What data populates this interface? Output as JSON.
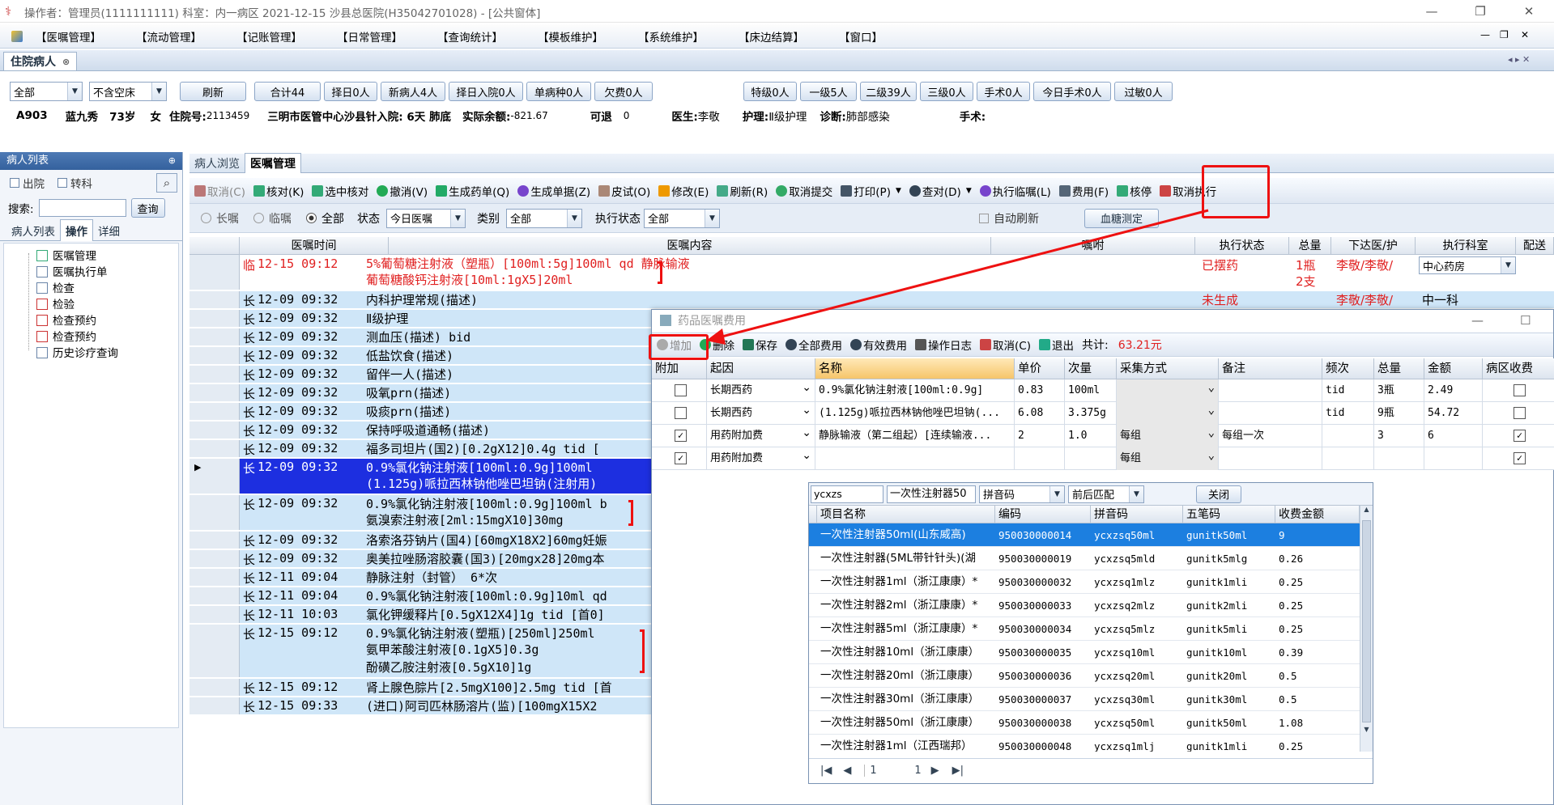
{
  "window": {
    "title": "操作者：管理员(1111111111) 科室：内一病区 2021-12-15 沙县总医院(H35042701028) - [公共窗体]",
    "min": "—",
    "restore": "❐",
    "close": "✕"
  },
  "menu": [
    "【医嘱管理】",
    "【流动管理】",
    "【记账管理】",
    "【日常管理】",
    "【查询统计】",
    "【模板维护】",
    "【系统维护】",
    "【床边结算】",
    "【窗口】"
  ],
  "doc_tab": "住院病人",
  "filters": {
    "scope": "全部",
    "bed": "不含空床",
    "refresh": "刷新",
    "buttons": [
      "合计44",
      "择日0人",
      "新病人4人",
      "择日入院0人",
      "单病种0人",
      "欠费0人"
    ],
    "buttons2": [
      "特级0人",
      "一级5人",
      "二级39人",
      "三级0人",
      "手术0人",
      "今日手术0人",
      "过敏0人"
    ]
  },
  "patient": {
    "bed": "A903",
    "name": "蓝九秀",
    "age": "73岁",
    "sex": "女",
    "inpatient_label": "住院号:",
    "inpatient_no": "2113459",
    "address": "三明市医管中心沙县针入院: 6天 肺底",
    "balance_label": "实际余额:",
    "balance": "-821.67",
    "retreat_label": "可退",
    "retreat": "0",
    "doctor_label": "医生:",
    "doctor": "李敬",
    "nursing_label": "护理:",
    "nursing": "Ⅱ级护理",
    "diag_label": "诊断:",
    "diag": "肺部感染",
    "op_label": "手术:"
  },
  "left": {
    "header": "病人列表",
    "pin": "⊕",
    "chk1": "出院",
    "chk2": "转科",
    "search_label": "搜索:",
    "query_btn": "查询",
    "tabs": [
      "病人列表",
      "操作",
      "详细"
    ],
    "tree": [
      "医嘱管理",
      "医嘱执行单",
      "检查",
      "检验",
      "检查预约",
      "检查预约",
      "历史诊疗查询"
    ]
  },
  "main": {
    "tabs": [
      "病人浏览",
      "医嘱管理"
    ],
    "toolbar": [
      "取消(C)",
      "核对(K)",
      "选中核对",
      "撤消(V)",
      "生成药单(Q)",
      "生成单据(Z)",
      "皮试(O)",
      "修改(E)",
      "刷新(R)",
      "取消提交",
      "打印(P)",
      "查对(D)",
      "执行临嘱(L)",
      "费用(F)",
      "核停",
      "取消执行"
    ],
    "filter": {
      "long": "长嘱",
      "temp": "临嘱",
      "all": "全部",
      "state_label": "状态",
      "state": "今日医嘱",
      "type_label": "类别",
      "type": "全部",
      "exec_label": "执行状态",
      "exec": "全部",
      "auto": "自动刷新",
      "blood_btn": "血糖测定"
    },
    "columns": [
      "医嘱时间",
      "医嘱内容",
      "嘱咐",
      "执行状态",
      "总量",
      "下达医/护",
      "执行科室",
      "配送"
    ],
    "rows": [
      {
        "type": "临",
        "time": "12-15 09:12",
        "content": "5%葡萄糖注射液（塑瓶）[100ml:5g]100ml qd 静脉输液",
        "content2": "葡萄糖酸钙注射液[10ml:1gX5]20ml",
        "status": "已摆药",
        "qty": "1瓶",
        "qty2": "2支",
        "doc": "李敬/李敬/",
        "dept": "中心药房"
      },
      {
        "type": "长",
        "time": "12-09 09:32",
        "content": "内科护理常规(描述)",
        "status": "未生成",
        "doc": "李敬/李敬/",
        "dept": "中一科"
      },
      {
        "type": "长",
        "time": "12-09 09:32",
        "content": "Ⅱ级护理"
      },
      {
        "type": "长",
        "time": "12-09 09:32",
        "content": "测血压(描述) bid"
      },
      {
        "type": "长",
        "time": "12-09 09:32",
        "content": "低盐饮食(描述)"
      },
      {
        "type": "长",
        "time": "12-09 09:32",
        "content": "留伴一人(描述)"
      },
      {
        "type": "长",
        "time": "12-09 09:32",
        "content": "吸氧prn(描述)"
      },
      {
        "type": "长",
        "time": "12-09 09:32",
        "content": "吸痰prn(描述)"
      },
      {
        "type": "长",
        "time": "12-09 09:32",
        "content": "保持呼吸道通畅(描述)"
      },
      {
        "type": "长",
        "time": "12-09 09:32",
        "content": "福多司坦片(国2)[0.2gX12]0.4g tid ["
      },
      {
        "type": "长",
        "time": "12-09 09:32",
        "content": "0.9%氯化钠注射液[100ml:0.9g]100ml",
        "content2": "(1.125g)哌拉西林钠他唑巴坦钠(注射用)"
      },
      {
        "type": "长",
        "time": "12-09 09:32",
        "content": "0.9%氯化钠注射液[100ml:0.9g]100ml b",
        "content2": "氨溴索注射液[2ml:15mgX10]30mg"
      },
      {
        "type": "长",
        "time": "12-09 09:32",
        "content": "洛索洛芬钠片(国4)[60mgX18X2]60mg妊娠"
      },
      {
        "type": "长",
        "time": "12-09 09:32",
        "content": "奥美拉唑肠溶胶囊(国3)[20mgx28]20mg本"
      },
      {
        "type": "长",
        "time": "12-11 09:04",
        "content": "静脉注射（封管） 6*次"
      },
      {
        "type": "长",
        "time": "12-11 09:04",
        "content": "0.9%氯化钠注射液[100ml:0.9g]10ml qd"
      },
      {
        "type": "长",
        "time": "12-11 10:03",
        "content": "氯化钾缓释片[0.5gX12X4]1g tid [首0]"
      },
      {
        "type": "长",
        "time": "12-15 09:12",
        "content": "0.9%氯化钠注射液(塑瓶)[250ml]250ml",
        "content2": "氨甲苯酸注射液[0.1gX5]0.3g",
        "content3": "酚磺乙胺注射液[0.5gX10]1g"
      },
      {
        "type": "长",
        "time": "12-15 09:12",
        "content": "肾上腺色腙片[2.5mgX100]2.5mg tid [首"
      },
      {
        "type": "长",
        "time": "12-15 09:33",
        "content": "(进口)阿司匹林肠溶片(监)[100mgX15X2"
      }
    ]
  },
  "dialog": {
    "title": "药品医嘱费用",
    "toolbar": [
      "增加",
      "删除",
      "保存",
      "全部费用",
      "有效费用",
      "操作日志",
      "取消(C)",
      "退出"
    ],
    "total_label": "共计:",
    "total": "63.21元",
    "columns": [
      "附加",
      "起因",
      "名称",
      "单价",
      "次量",
      "采集方式",
      "备注",
      "频次",
      "总量",
      "金额",
      "病区收费"
    ],
    "rows": [
      {
        "checked": false,
        "cause": "长期西药",
        "name": "0.9%氯化钠注射液[100ml:0.9g]",
        "price": "0.83",
        "dose": "100ml",
        "method": "",
        "note": "",
        "freq": "tid",
        "qty": "3瓶",
        "amount": "2.49",
        "ward": false
      },
      {
        "checked": false,
        "cause": "长期西药",
        "name": "(1.125g)哌拉西林钠他唑巴坦钠(...",
        "price": "6.08",
        "dose": "3.375g",
        "method": "",
        "note": "",
        "freq": "tid",
        "qty": "9瓶",
        "amount": "54.72",
        "ward": false
      },
      {
        "checked": true,
        "cause": "用药附加费",
        "name": "静脉输液（第二组起）[连续输液...",
        "price": "2",
        "dose": "1.0",
        "method": "每组",
        "note": "每组一次",
        "freq": "",
        "qty": "3",
        "amount": "6",
        "ward": true
      },
      {
        "checked": true,
        "cause": "用药附加费",
        "name": "",
        "price": "",
        "dose": "",
        "method": "每组",
        "note": "",
        "freq": "",
        "qty": "",
        "amount": "",
        "ward": true
      }
    ]
  },
  "lookup": {
    "query": "ycxzs",
    "item": "一次性注射器50",
    "mode": "拼音码",
    "match": "前后匹配",
    "close": "关闭",
    "columns": [
      "项目名称",
      "编码",
      "拼音码",
      "五笔码",
      "收费金额"
    ],
    "rows": [
      [
        "一次性注射器50ml(山东威高)",
        "950030000014",
        "ycxzsq50ml",
        "gunitk50ml",
        "9"
      ],
      [
        "一次性注射器(5ML带针针头)(湖",
        "950030000019",
        "ycxzsq5mld",
        "gunitk5mlg",
        "0.26"
      ],
      [
        "一次性注射器1ml（浙江康康）*",
        "950030000032",
        "ycxzsq1mlz",
        "gunitk1mli",
        "0.25"
      ],
      [
        "一次性注射器2ml（浙江康康）*",
        "950030000033",
        "ycxzsq2mlz",
        "gunitk2mli",
        "0.25"
      ],
      [
        "一次性注射器5ml（浙江康康）*",
        "950030000034",
        "ycxzsq5mlz",
        "gunitk5mli",
        "0.25"
      ],
      [
        "一次性注射器10ml（浙江康康）",
        "950030000035",
        "ycxzsq10ml",
        "gunitk10ml",
        "0.39"
      ],
      [
        "一次性注射器20ml（浙江康康）",
        "950030000036",
        "ycxzsq20ml",
        "gunitk20ml",
        "0.5"
      ],
      [
        "一次性注射器30ml（浙江康康）",
        "950030000037",
        "ycxzsq30ml",
        "gunitk30ml",
        "0.5"
      ],
      [
        "一次性注射器50ml（浙江康康）",
        "950030000038",
        "ycxzsq50ml",
        "gunitk50ml",
        "1.08"
      ],
      [
        "一次性注射器1ml（江西瑞邦）",
        "950030000048",
        "ycxzsq1mlj",
        "gunitk1mli",
        "0.25"
      ]
    ],
    "pager": {
      "page": "1",
      "total": "1"
    }
  }
}
